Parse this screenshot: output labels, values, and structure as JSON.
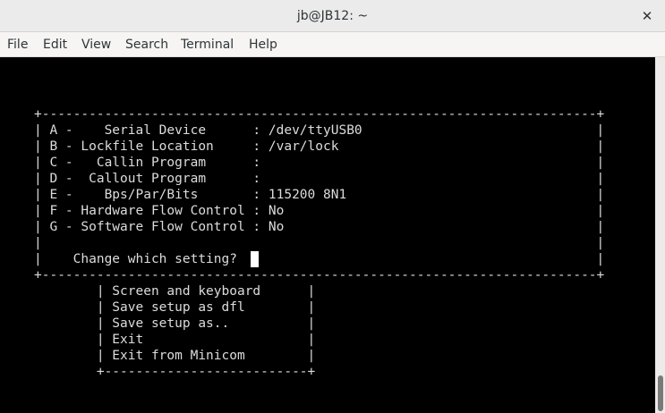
{
  "window": {
    "title": "jb@JB12: ~",
    "close_glyph": "✕"
  },
  "menubar": {
    "items": [
      "File",
      "Edit",
      "View",
      "Search",
      "Terminal",
      "Help"
    ]
  },
  "terminal": {
    "settings_box": {
      "border_top": "+-----------------------------------------------------------------------+",
      "rows": [
        "| A -    Serial Device      : /dev/ttyUSB0                              |",
        "| B - Lockfile Location     : /var/lock                                 |",
        "| C -   Callin Program      :                                           |",
        "| D -  Callout Program      :                                           |",
        "| E -    Bps/Par/Bits       : 115200 8N1                                |",
        "| F - Hardware Flow Control : No                                        |",
        "| G - Software Flow Control : No                                        |",
        "|                                                                       |",
        "|    Change which setting?                                              |"
      ],
      "border_bottom": "+-----------------------------------------------------------------------+"
    },
    "config_menu": {
      "rows": [
        "        | Screen and keyboard      |",
        "        | Save setup as dfl        |",
        "        | Save setup as..          |",
        "        | Exit                     |",
        "        | Exit from Minicom        |"
      ],
      "border_bottom": "        +--------------------------+"
    }
  },
  "colors": {
    "terminal_bg": "#000000",
    "terminal_fg": "#dcdcdc",
    "titlebar_bg": "#ebebeb"
  }
}
